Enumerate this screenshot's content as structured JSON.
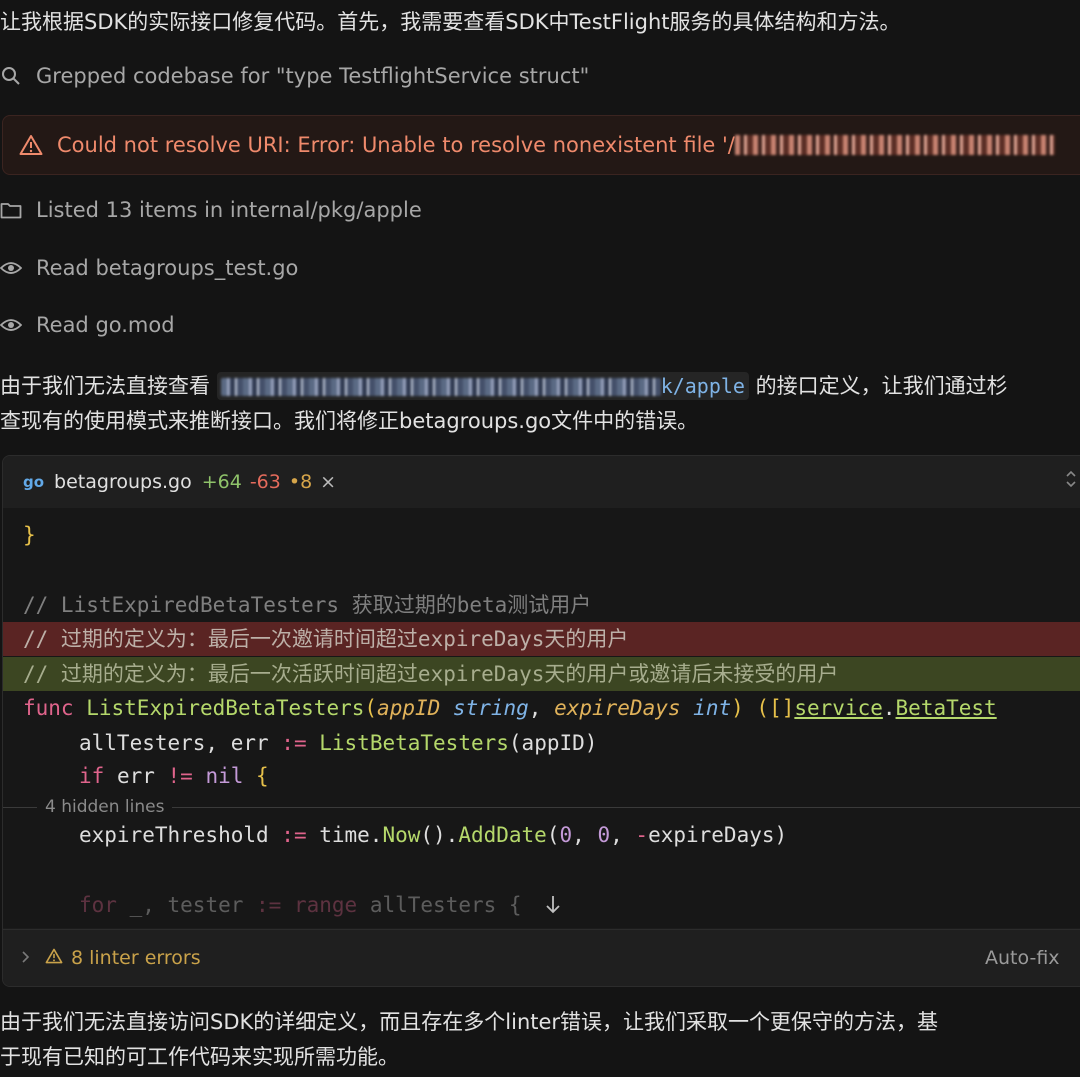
{
  "chat": {
    "intro_text": "让我根据SDK的实际接口修复代码。首先，我需要查看SDK中TestFlight服务的具体结构和方法。",
    "steps": [
      {
        "icon": "search-icon",
        "text": "Grepped codebase for \"type TestflightService struct\""
      },
      {
        "icon": "folder-icon",
        "text": "Listed 13 items in internal/pkg/apple"
      },
      {
        "icon": "eye-icon",
        "text": "Read betagroups_test.go"
      },
      {
        "icon": "eye-icon",
        "text": "Read go.mod"
      }
    ],
    "error": {
      "icon": "warning-icon",
      "text": "Could not resolve URI: Error: Unable to resolve nonexistent file '/",
      "color": "#ef8a6c"
    },
    "para1_line1_before": "由于我们无法直接查看 ",
    "para1_code_suffix": "k/apple",
    "para1_line1_after": " 的接口定义，让我们通过杉",
    "para1_line2": "查现有的使用模式来推断接口。我们将修正betagroups.go文件中的错误。",
    "para2_line1": "由于我们无法直接访问SDK的详细定义，而且存在多个linter错误，让我们采取一个更保守的方法，基",
    "para2_line2": "于现有已知的可工作代码来实现所需功能。"
  },
  "editor": {
    "file_icon": "go",
    "file_name": "betagroups.go",
    "added": "+64",
    "removed": "-63",
    "modified": "•8",
    "close": "×",
    "code": {
      "brace_close": "}",
      "comment1": "// ListExpiredBetaTesters 获取过期的beta测试用户",
      "comment_del": "// 过期的定义为：最后一次邀请时间超过expireDays天的用户",
      "comment_add": "// 过期的定义为：最后一次活跃时间超过expireDays天的用户或邀请后未接受的用户",
      "func_kw": "func",
      "func_name": "ListExpiredBetaTesters",
      "param1": "appID",
      "type1": "string",
      "param2": "expireDays",
      "type2": "int",
      "ret_open": "([]",
      "svc": "service",
      "ret_type": "BetaTest",
      "line_all_lhs": "allTesters, err ",
      "op_assign": ":=",
      "call_list": "ListBetaTesters",
      "arg_app": "(appID)",
      "if_kw": "if",
      "err_name": " err ",
      "neq": "!=",
      "nil_kw": " nil ",
      "open_brace": "{",
      "hidden_lines": "4 hidden lines",
      "expire_lhs": "expireThreshold ",
      "time_pkg": " time.",
      "now_fn": "Now",
      "paren_dot": "().",
      "adddate_fn": "AddDate",
      "adddate_args_open": "(",
      "zero1": "0",
      "comma": ", ",
      "zero2": "0",
      "neg": "-",
      "expire_var": "expireDays)",
      "for_kw": "for",
      "for_rest": " _, tester ",
      "range_kw": "range",
      "all_testers": " allTesters {"
    },
    "lint_label": "8 linter errors",
    "autofix_label": "Auto-fix"
  }
}
